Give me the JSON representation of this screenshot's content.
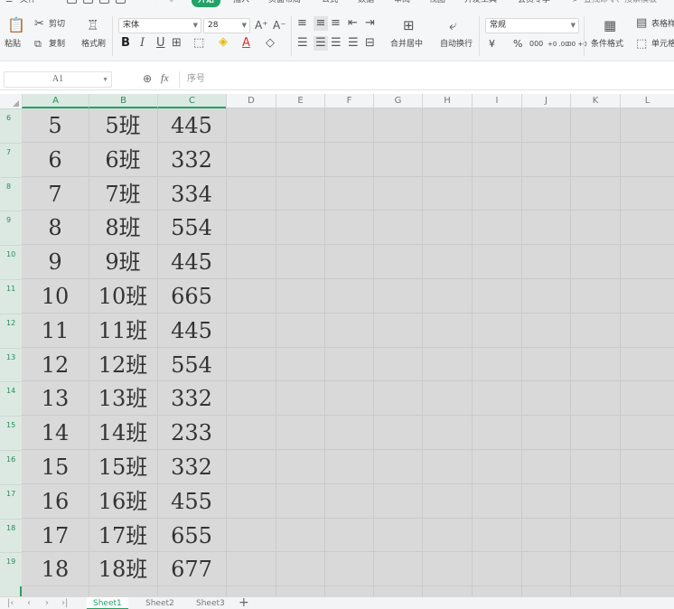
{
  "menu": {
    "file": "文件",
    "tabs": [
      "开始",
      "插入",
      "页面布局",
      "公式",
      "数据",
      "审阅",
      "视图",
      "开发工具",
      "会员专享"
    ],
    "active_tab": "开始",
    "search_placeholder": "查找命令、搜索模板"
  },
  "ribbon": {
    "cut": "剪切",
    "paste": "粘贴",
    "copy": "复制",
    "format_painter": "格式刷",
    "font_name": "宋体",
    "font_size": "28",
    "bold": "B",
    "italic": "I",
    "underline": "U",
    "merge_center": "合并居中",
    "wrap_text": "自动换行",
    "number_format": "常规",
    "currency": "¥",
    "percent": "%",
    "thousands": "000",
    "inc_decimal": "+0 .00",
    "dec_decimal": ".00 +0",
    "conditional_format": "条件格式",
    "table_style": "表格样式",
    "cell_style": "单元格"
  },
  "formula_bar": {
    "name_box": "A1",
    "fx": "fx",
    "content": "序号"
  },
  "columns": [
    "A",
    "B",
    "C",
    "D",
    "E",
    "F",
    "G",
    "H",
    "I",
    "J",
    "K",
    "L"
  ],
  "rows": [
    {
      "num": "6",
      "a": "5",
      "b": "5班",
      "c": "445"
    },
    {
      "num": "7",
      "a": "6",
      "b": "6班",
      "c": "332"
    },
    {
      "num": "8",
      "a": "7",
      "b": "7班",
      "c": "334"
    },
    {
      "num": "9",
      "a": "8",
      "b": "8班",
      "c": "554"
    },
    {
      "num": "10",
      "a": "9",
      "b": "9班",
      "c": "445"
    },
    {
      "num": "11",
      "a": "10",
      "b": "10班",
      "c": "665"
    },
    {
      "num": "12",
      "a": "11",
      "b": "11班",
      "c": "445"
    },
    {
      "num": "13",
      "a": "12",
      "b": "12班",
      "c": "554"
    },
    {
      "num": "14",
      "a": "13",
      "b": "13班",
      "c": "332"
    },
    {
      "num": "15",
      "a": "14",
      "b": "14班",
      "c": "233"
    },
    {
      "num": "16",
      "a": "15",
      "b": "15班",
      "c": "332"
    },
    {
      "num": "17",
      "a": "16",
      "b": "16班",
      "c": "455"
    },
    {
      "num": "18",
      "a": "17",
      "b": "17班",
      "c": "655"
    },
    {
      "num": "19",
      "a": "18",
      "b": "18班",
      "c": "677"
    }
  ],
  "sheets": [
    "Sheet1",
    "Sheet2",
    "Sheet3"
  ],
  "active_sheet": "Sheet1",
  "colors": {
    "accent": "#21a366",
    "selection": "#d9d9d9"
  }
}
